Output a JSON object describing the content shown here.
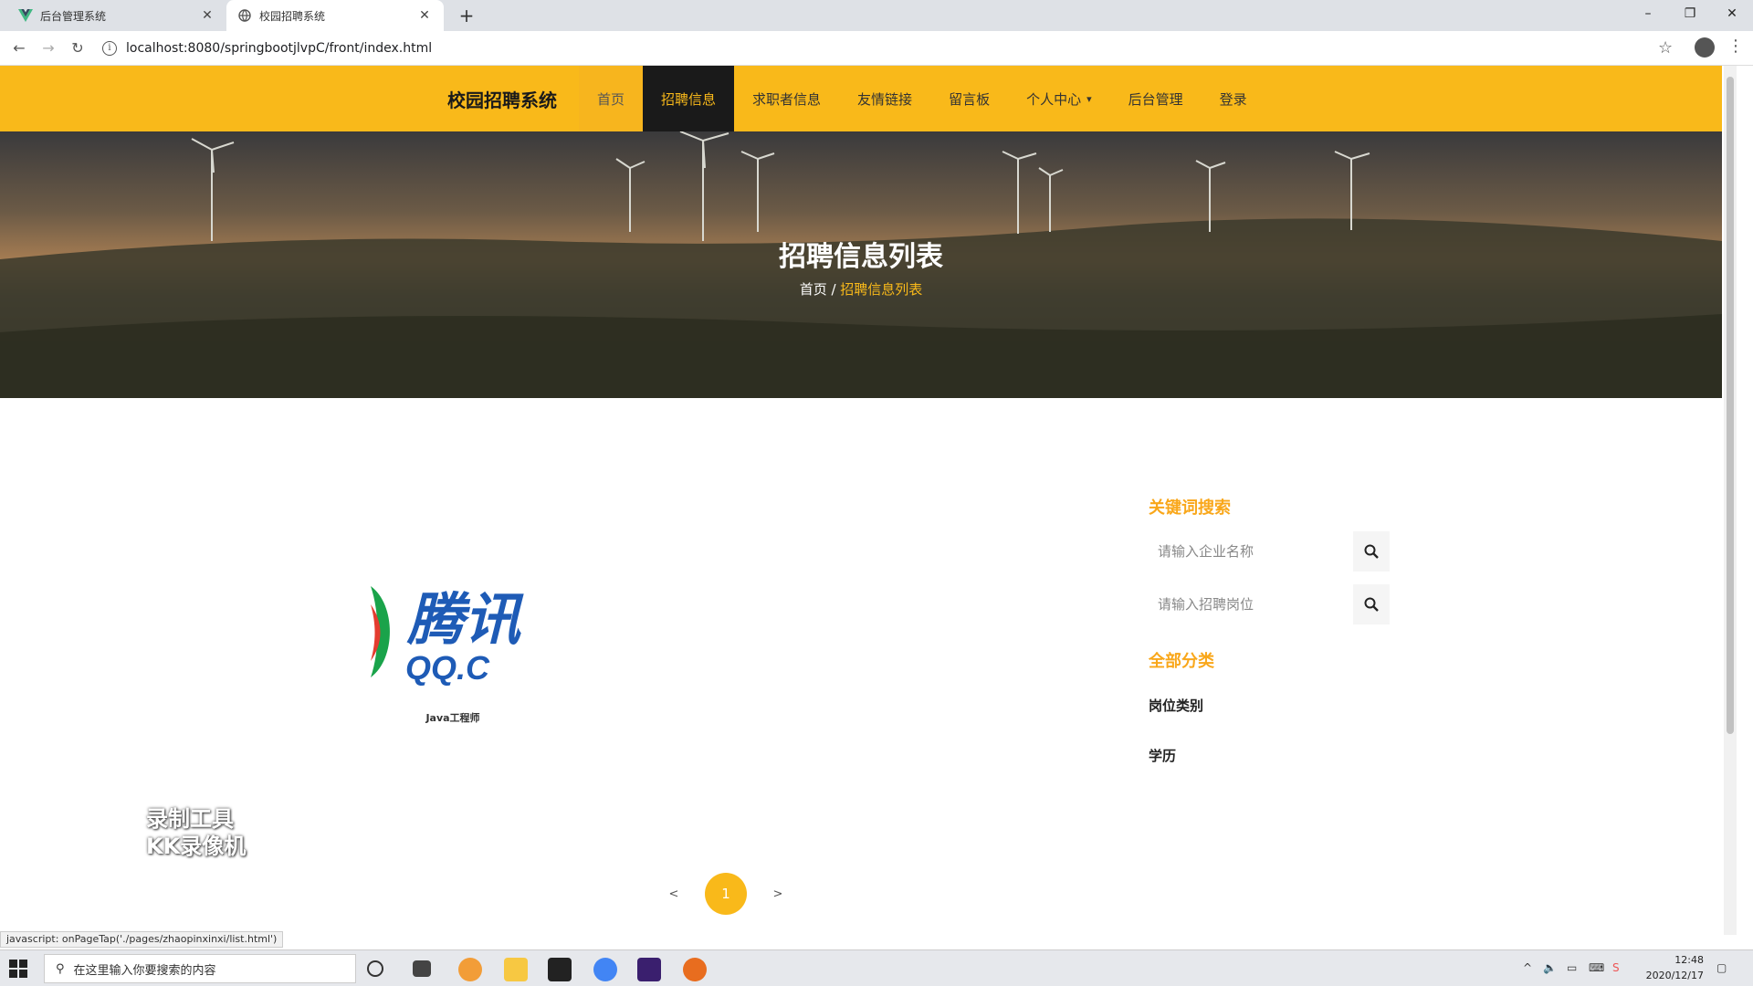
{
  "browser": {
    "tabs": [
      {
        "title": "后台管理系统"
      },
      {
        "title": "校园招聘系统"
      }
    ],
    "new_tab": "+",
    "url": "localhost:8080/springbootjlvpC/front/index.html",
    "window_controls": {
      "minimize": "–",
      "restore": "❐",
      "close": "✕"
    }
  },
  "header": {
    "brand": "校园招聘系统",
    "nav": [
      {
        "label": "首页"
      },
      {
        "label": "招聘信息"
      },
      {
        "label": "求职者信息"
      },
      {
        "label": "友情链接"
      },
      {
        "label": "留言板"
      },
      {
        "label": "个人中心"
      },
      {
        "label": "后台管理"
      },
      {
        "label": "登录"
      }
    ]
  },
  "hero": {
    "title": "招聘信息列表",
    "breadcrumb_home": "首页",
    "breadcrumb_sep": " / ",
    "breadcrumb_current": "招聘信息列表"
  },
  "listing": {
    "items": [
      {
        "label": "Java工程师",
        "logo_text": "腾讯",
        "logo_sub": "QQ.C"
      }
    ]
  },
  "sidebar": {
    "search_title": "关键词搜索",
    "company_placeholder": "请输入企业名称",
    "position_placeholder": "请输入招聘岗位",
    "category_title": "全部分类",
    "categories": [
      {
        "label": "岗位类别"
      },
      {
        "label": "学历"
      }
    ]
  },
  "pagination": {
    "prev": "<",
    "current": "1",
    "next": ">"
  },
  "watermark": {
    "line1": "录制工具",
    "line2": "KK录像机"
  },
  "status_bar": "javascript: onPageTap('./pages/zhaopinxinxi/list.html')",
  "taskbar": {
    "search_placeholder": "在这里输入你要搜索的内容",
    "time": "12:48",
    "date": "2020/12/17"
  },
  "colors": {
    "accent": "#f9b91a",
    "header_bg": "#f9b91a",
    "active_nav_bg": "#1a1a1a"
  }
}
